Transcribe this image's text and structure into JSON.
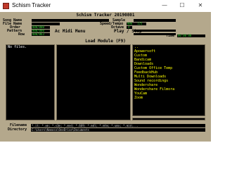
{
  "window": {
    "title": "Schism Tracker",
    "minimize_glyph": "—",
    "maximize_glyph": "☐",
    "close_glyph": "✕"
  },
  "header": {
    "title": "Schism Tracker 20190801"
  },
  "song_info": {
    "song_name_label": "Song Name",
    "file_name_label": "File Name",
    "order_label": "Order",
    "pattern_label": "Pattern",
    "row_label": "Row",
    "order_value": "000/000",
    "pattern_value": "000/000",
    "row_value": "000/063",
    "sample_label": "Sample",
    "speed_tempo_label": "Speed/Tempo",
    "octave_label": "Octave",
    "speed_value": "006",
    "tempo_value": "125",
    "octave_value": "4"
  },
  "mode_row": {
    "mode": "Ac Midi Menu",
    "play_status": "Play / Stop",
    "time_label": "Time",
    "time_value": "00:00:00"
  },
  "load_module": {
    "title": "Load Module (F9)",
    "files_placeholder": "No files.",
    "directories": [
      "..",
      "Apowersoft",
      "Custom",
      "Bandicam",
      "Downloads",
      "Custom Office Temp",
      "FeedbackHub",
      "Multi Downloads",
      "Sound recordings",
      "Wondershare",
      "Wondershare Filmora",
      "YouCam",
      "Zoom"
    ],
    "filename_label": "Filename",
    "filename_value": "*.it; *.xm; *.s3m; *.mod; *.669; *.mdl; *.mtm; *.umx; *.mid;...",
    "directory_label": "Directory",
    "directory_value": "C:\\Users\\Nemoso\\OneDrive\\Documents"
  }
}
